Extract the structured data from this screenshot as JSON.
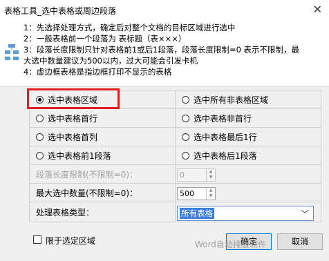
{
  "window": {
    "title": "表格工具_选中表格或周边段落",
    "close": "✕"
  },
  "info": {
    "lines": [
      "1：先选择处理方式，确定后对整个文档的目标区域进行选中",
      "2：一般表格前一个段落为 表标题（表×××）",
      "3：段落长度限制只针对表格前1或后1段落，段落长度限制=0 表示不限制，最",
      "大选中数量建议为500以内，过大可能会引发卡机",
      "4：虚边框表格是指边框打印不显示的表格"
    ]
  },
  "options": {
    "r1c1": "选中表格区域",
    "r1c2": "选中所有非表格区域",
    "r2c1": "选中表格首行",
    "r2c2": "选中表格非首行",
    "r3c1": "选中表格首列",
    "r3c2": "选中表格最后1行",
    "r4c1": "选中表格前1段落",
    "r4c2": "选中表格后1段落"
  },
  "fields": {
    "para_limit_label": "段落长度限制(不限制=0)：",
    "para_limit_value": "0",
    "max_select_label": "最大选中数量(不限制=0)：",
    "max_select_value": "500",
    "table_type_label": "处理表格类型：",
    "table_type_value": "所有表格"
  },
  "footer": {
    "limit_checkbox": "限于选定区域",
    "ok": "确定",
    "cancel": "取消",
    "watermark": "Word自动排版软件"
  }
}
